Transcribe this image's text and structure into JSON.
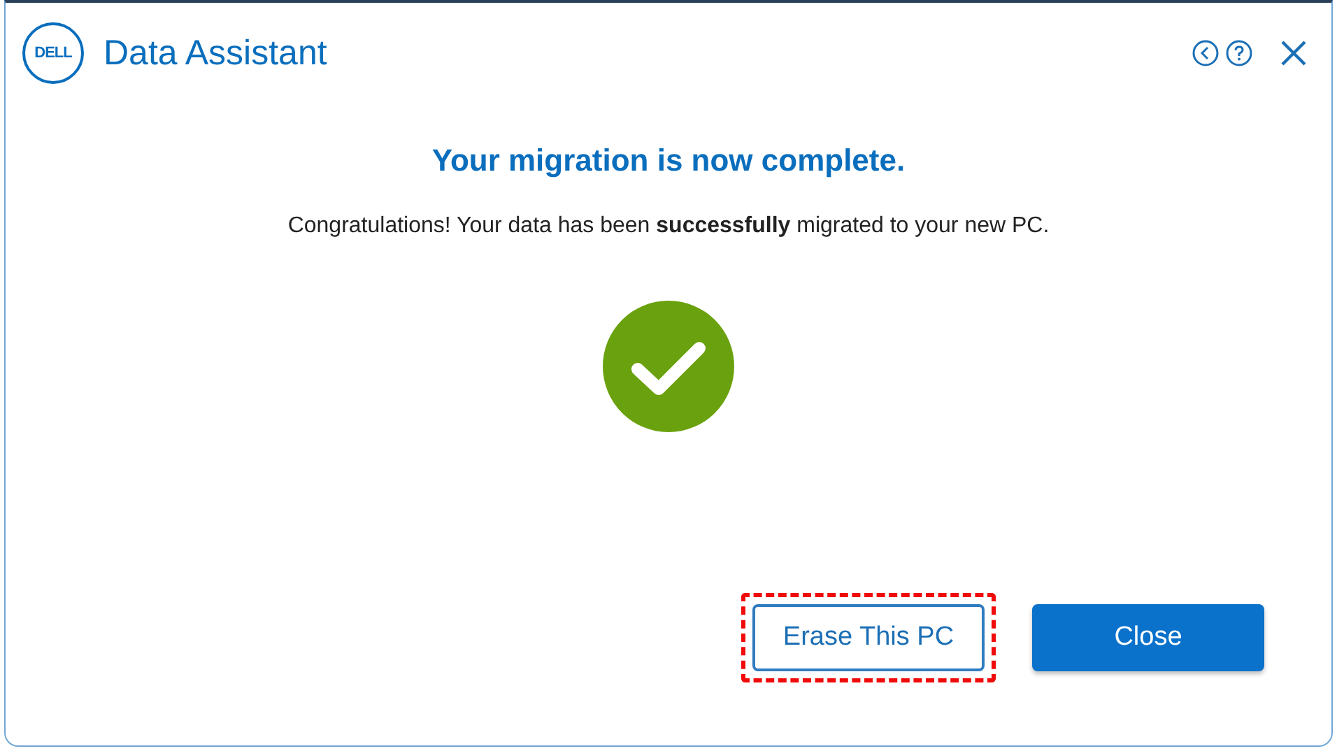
{
  "window": {
    "logo": "DELL",
    "title": "Data Assistant"
  },
  "heading": "Your migration is now complete.",
  "message": "Congratulations! Your data has been **successfully** migrated to your new PC.",
  "status": {
    "kind": "success"
  },
  "buttons": [
    {
      "label": "Erase This PC",
      "kind": "secondary",
      "highlighted": true
    },
    {
      "label": "Close",
      "kind": "primary",
      "highlighted": false
    }
  ]
}
